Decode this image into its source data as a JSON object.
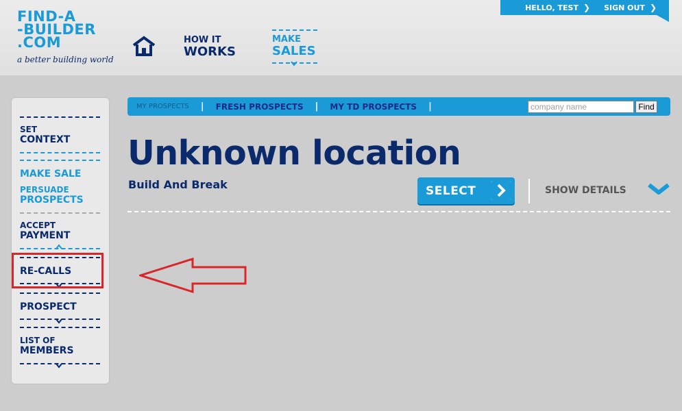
{
  "brand": {
    "logo_lines": [
      "FIND-A",
      "-BUILDER",
      ".COM"
    ],
    "tagline": "a better building world"
  },
  "top_nav": {
    "home_icon": "home-icon",
    "how_it_works": {
      "small": "HOW IT",
      "big": "WORKS"
    },
    "make_sales": {
      "small": "MAKE",
      "big": "SALES"
    }
  },
  "user_bar": {
    "greeting": "HELLO, TEST",
    "sign_out": "SIGN OUT",
    "chevron_icon": "chevron-right-icon"
  },
  "sidebar": {
    "set_context": {
      "small": "SET",
      "big": "CONTEXT"
    },
    "make_sale": "MAKE SALE",
    "persuade_prospects": {
      "small": "PERSUADE",
      "big": "PROSPECTS"
    },
    "accept_payment": {
      "small": "ACCEPT",
      "big": "PAYMENT"
    },
    "re_calls": "RE-CALLS",
    "prospect": "PROSPECT",
    "list_of_members": {
      "small": "LIST OF",
      "big": "MEMBERS"
    }
  },
  "tabs": {
    "items": [
      "MY PROSPECTS",
      "FRESH PROSPECTS",
      "MY TD PROSPECTS"
    ],
    "separator": "|",
    "search_placeholder": "company name",
    "find_label": "Find"
  },
  "main": {
    "title": "Unknown location",
    "subtitle": "Build And Break",
    "select_label": "SELECT",
    "show_details_label": "SHOW DETAILS"
  },
  "colors": {
    "brand_blue": "#1a9ad6",
    "navy": "#0b2a6b",
    "annotation_red": "#d9262b",
    "background": "#cdcdcd"
  }
}
